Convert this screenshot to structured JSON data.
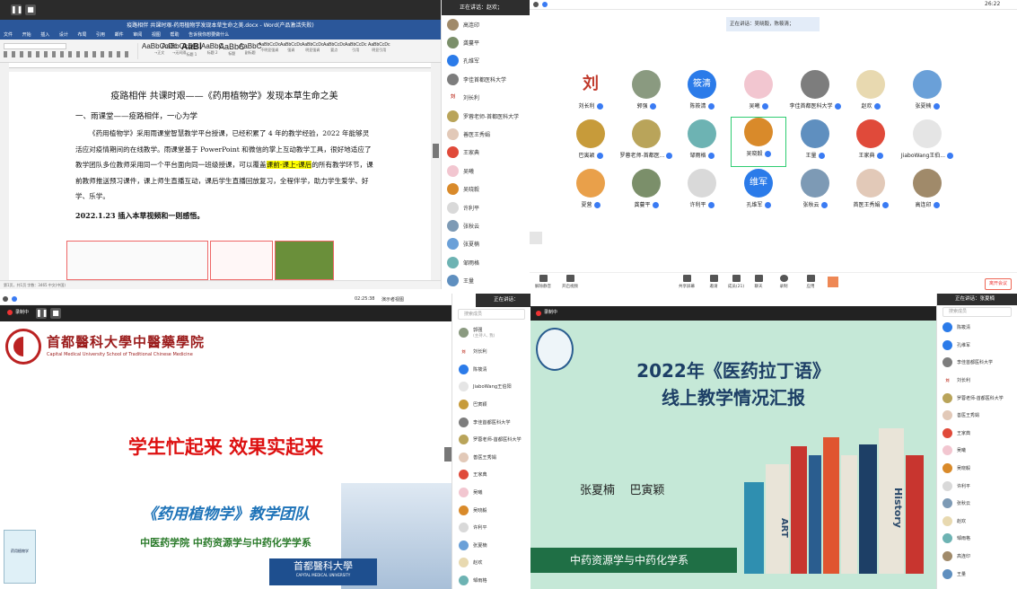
{
  "q1": {
    "recording_btns": [
      "❚❚",
      "■"
    ],
    "window_title": "疫路相伴 共课时艰-药用植物学发现本草生命之美.docx - Word(产品激活失败)",
    "menu": [
      "文件",
      "开始",
      "插入",
      "设计",
      "布局",
      "引用",
      "邮件",
      "审阅",
      "视图",
      "帮助",
      "告诉我你想要做什么"
    ],
    "styles": [
      {
        "big": "AaBbCcDc",
        "sm": "→正文"
      },
      {
        "big": "AaBbCcDc",
        "sm": "→无间隔"
      },
      {
        "big": "AaBl",
        "sm": "标题 1"
      },
      {
        "big": "AaBbC",
        "sm": "标题 2"
      },
      {
        "big": "AaBbC",
        "sm": "标题"
      },
      {
        "big": "AaBbC",
        "sm": "副标题"
      },
      {
        "big": "AaBbCcDc",
        "sm": "不明显强调"
      },
      {
        "big": "AaBbCcDc",
        "sm": "强调"
      },
      {
        "big": "AaBbCcDc",
        "sm": "明显强调"
      },
      {
        "big": "AaBbCcDc",
        "sm": "要点"
      },
      {
        "big": "AaBbCcDc",
        "sm": "引用"
      },
      {
        "big": "AaBbCcDc",
        "sm": "明显引用"
      }
    ],
    "doc_title": "疫路相伴 共课时艰——《药用植物学》发现本草生命之美",
    "doc_heading": "一、雨课堂——疫路相伴，一心为学",
    "doc_para_a": "《药用植物学》采用雨课堂智慧教学平台授课，已经积累了 4 年的教学经验，2022 年能够灵活应对疫情期间的在线教学。雨课堂基于 PowerPoint 和微信的掌上互动教学工具，很好地适应了教学团队多位教师采用同一个平台面向同一班级授课，可以覆盖",
    "doc_para_hl": "课前-课上-课后",
    "doc_para_b": "的所有教学环节，课前教师推送预习课件，课上师生直播互动，课后学生直播回放复习，全程伴学，助力学生爱学、好学、乐学。",
    "doc_date": "2022.1.23 插入本草视频和一则感悟。",
    "status": "第1页，共1页  字数：3465  中文(中国)"
  },
  "p1": {
    "header": "正在讲话：赵欢；",
    "items": [
      "高连印",
      "龚蔓平",
      "孔维军",
      "李佳首都医科大学",
      "刘长利",
      "罗蓉老师-首都医科大学",
      "善医王秀娟",
      "王家典",
      "吴曦",
      "吴晓毅",
      "许利平",
      "张秋云",
      "张夏楠",
      "邹雨格",
      "王量"
    ]
  },
  "q2": {
    "time": "26:22",
    "speaking": "正在讲话：吴晓毅，陈筱清；",
    "tiles": [
      {
        "name": "刘长利",
        "av": "刘",
        "color": "#ffffff",
        "fg": "#c0392b"
      },
      {
        "name": "郭强",
        "av": "",
        "color": "#8a9a80"
      },
      {
        "name": "陈筱清",
        "av": "筱清",
        "color": "#2b7be9"
      },
      {
        "name": "吴曦",
        "av": "",
        "color": "#f2c6d0"
      },
      {
        "name": "李佳首都医科大学",
        "av": "",
        "color": "#7d7d7d"
      },
      {
        "name": "赵欢",
        "av": "",
        "color": "#e8d9b0"
      },
      {
        "name": "张夏楠",
        "av": "",
        "color": "#6aa0d8"
      },
      {
        "name": "巴寅颖",
        "av": "",
        "color": "#c79b3a"
      },
      {
        "name": "罗蓉老师-首都医...",
        "av": "",
        "color": "#b9a45a"
      },
      {
        "name": "邹雨格",
        "av": "",
        "color": "#6db3b3"
      },
      {
        "name": "吴晓毅",
        "av": "",
        "color": "#d98a2a"
      },
      {
        "name": "王量",
        "av": "",
        "color": "#5f8fbf"
      },
      {
        "name": "王家典",
        "av": "",
        "color": "#e04a3a"
      },
      {
        "name": "JiaboWang王伯...",
        "av": "",
        "color": "#e5e5e5"
      },
      {
        "name": "夏营",
        "av": "",
        "color": "#e9a04a"
      },
      {
        "name": "龚蔓平",
        "av": "",
        "color": "#7b8f6a"
      },
      {
        "name": "许利平",
        "av": "",
        "color": "#d9d9d9"
      },
      {
        "name": "孔维军",
        "av": "维军",
        "color": "#2b7be9"
      },
      {
        "name": "张秋云",
        "av": "",
        "color": "#7d9ab5"
      },
      {
        "name": "首医王秀娟",
        "av": "",
        "color": "#e2c9b8"
      },
      {
        "name": "高连印",
        "av": "",
        "color": "#a08a6a"
      }
    ],
    "toolbar": [
      "解除静音",
      "开启视频",
      "共享屏幕",
      "邀请",
      "成员(21)",
      "聊天",
      "录制",
      "应用"
    ],
    "leave": "离开会议"
  },
  "q3": {
    "time": "02:25:38",
    "view": "演示者视图",
    "rec_label": "录制中",
    "uni_cn": "首都醫科大學中醫藥學院",
    "uni_en": "Capital Medical University School of Traditional Chinese Medicine",
    "slogan": "学生忙起来  效果实起来",
    "team": "《药用植物学》教学团队",
    "dept": "中医药学院 中药资源学与中药化学学系",
    "book": "药用植物学",
    "stamp": "首都醫科大學",
    "stamp_en": "CAPITAL MEDICAL UNIVERSITY"
  },
  "p2": {
    "header": "正在讲话：",
    "search": "搜索成员",
    "items": [
      {
        "name": "郭强",
        "sub": "(主持人, 我)"
      },
      {
        "name": "刘长利"
      },
      {
        "name": "陈筱清"
      },
      {
        "name": "JiaboWang王伯阳"
      },
      {
        "name": "巴寅颖"
      },
      {
        "name": "李佳首都医科大学"
      },
      {
        "name": "罗蓉老师-首都医科大学"
      },
      {
        "name": "善医王秀娟"
      },
      {
        "name": "王家典"
      },
      {
        "name": "吴曦"
      },
      {
        "name": "吴晓毅"
      },
      {
        "name": "许利平"
      },
      {
        "name": "张夏楠"
      },
      {
        "name": "赵欢"
      },
      {
        "name": "邹雨格"
      }
    ]
  },
  "q4": {
    "rec_label": "录制中",
    "title1": "2022年《医药拉丁语》",
    "title2": "线上教学情况汇报",
    "names": "张夏楠    巴寅颖",
    "dept": "中药资源学与中药化学系",
    "book1": "ART",
    "book2": "History"
  },
  "p3": {
    "header": "正在讲话：张夏楠",
    "search": "搜索成员",
    "items": [
      "陈筱清",
      "孔维军",
      "李佳首都医科大学",
      "刘长利",
      "罗蓉老师-首都医科大学",
      "善医王秀娟",
      "王家典",
      "吴曦",
      "吴晓毅",
      "许利平",
      "张秋云",
      "赵欢",
      "邹雨格",
      "高连印",
      "王量"
    ]
  }
}
